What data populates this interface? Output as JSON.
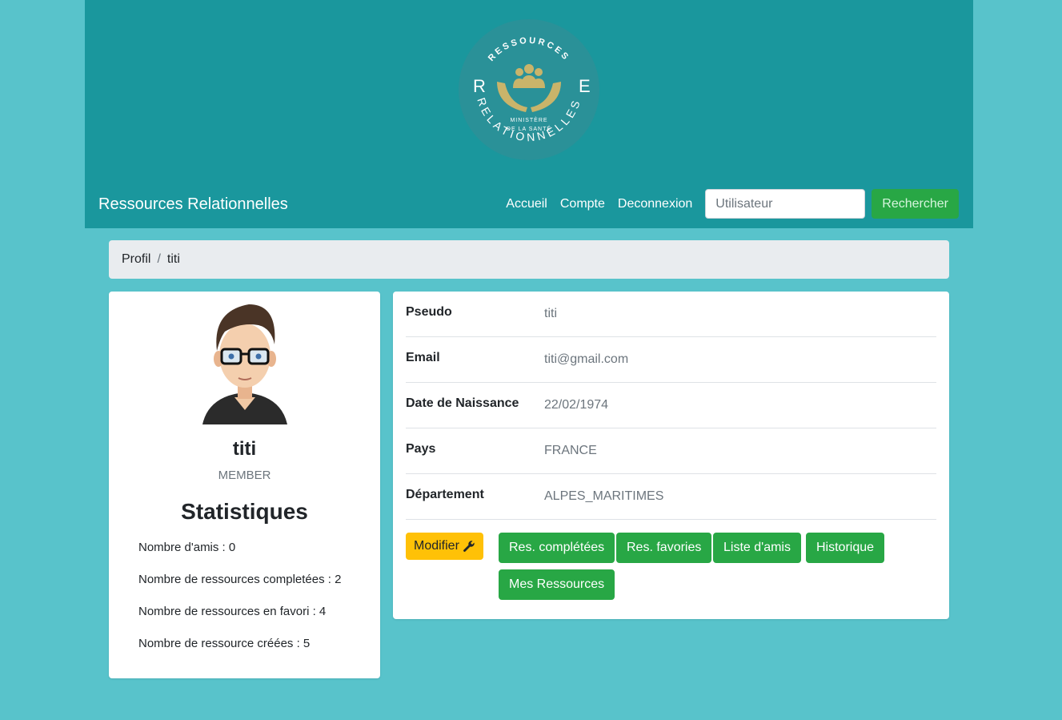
{
  "header": {
    "logo": {
      "top_text": "RESSOURCES",
      "bottom_text": "RELATIONNELLES",
      "left_letter": "R",
      "right_letter": "E",
      "center_line1": "MINISTÈRE",
      "center_line2": "DE LA SANTÉ",
      "colors": {
        "circle": "#2a9198",
        "gold": "#c9b46a"
      }
    },
    "brand": "Ressources Relationnelles",
    "nav": [
      "Accueil",
      "Compte",
      "Deconnexion"
    ],
    "search": {
      "placeholder": "Utilisateur",
      "button": "Rechercher"
    }
  },
  "breadcrumb": {
    "items": [
      "Profil",
      "titi"
    ],
    "separator": "/"
  },
  "profile": {
    "username": "titi",
    "role": "MEMBER",
    "stats_title": "Statistiques",
    "stats": [
      "Nombre d'amis : 0",
      "Nombre de ressources completées : 2",
      "Nombre de ressources en favori : 4",
      "Nombre de ressource créées : 5"
    ]
  },
  "details": [
    {
      "label": "Pseudo",
      "value": "titi"
    },
    {
      "label": "Email",
      "value": "titi@gmail.com"
    },
    {
      "label": "Date de Naissance",
      "value": "22/02/1974"
    },
    {
      "label": "Pays",
      "value": "FRANCE"
    },
    {
      "label": "Département",
      "value": "ALPES_MARITIMES"
    }
  ],
  "actions": {
    "edit": "Modifier",
    "edit_icon": "wrench-icon",
    "buttons": [
      "Res. complétées",
      "Res. favories",
      "Liste d'amis",
      "Historique",
      "Mes Ressources"
    ]
  },
  "colors": {
    "page_bg": "#58c3cb",
    "header_bg": "#1a979d",
    "success": "#28a745",
    "warning": "#ffc107"
  }
}
